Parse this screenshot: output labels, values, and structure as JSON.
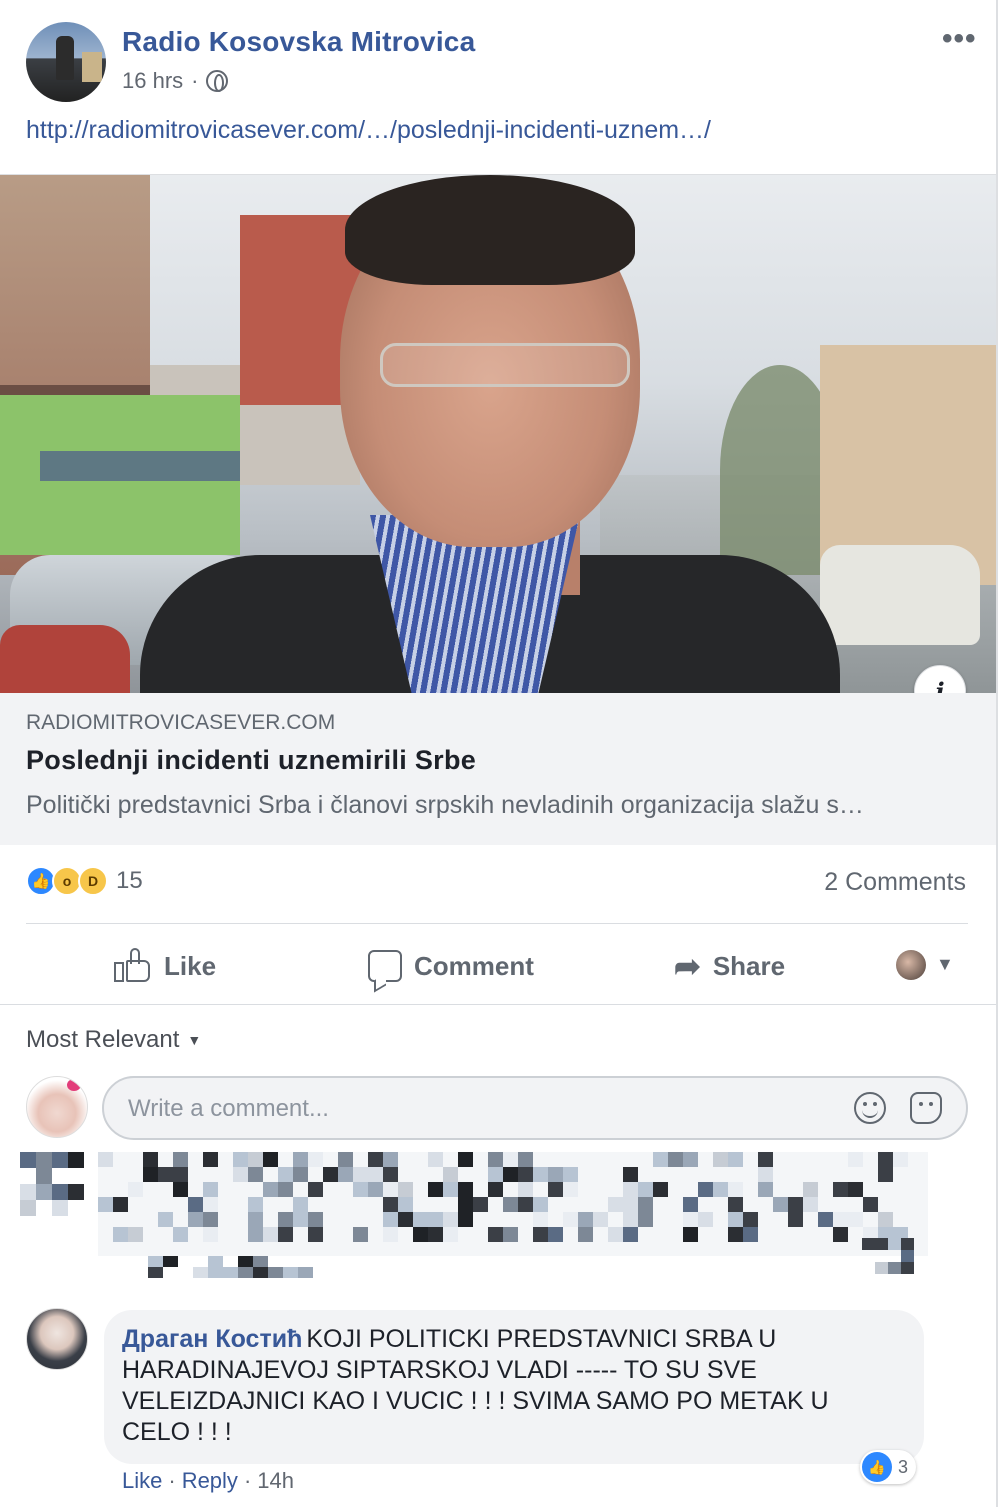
{
  "post": {
    "page_name": "Radio Kosovska Mitrovica",
    "time": "16 hrs",
    "separator": "·",
    "audience_icon": "globe-icon",
    "more_icon": "ellipsis-icon",
    "link_text": "http://radiomitrovicasever.com/…/poslednji-incidenti-uznem…/"
  },
  "preview": {
    "domain": "RADIOMITROVICASEVER.COM",
    "title": "Poslednji incidenti uznemirili Srbe",
    "description": "Politički predstavnici Srba i članovi srpskih nevladinih organizacija slažu s…",
    "info_label": "i"
  },
  "reactions": {
    "icons": [
      "like-reaction-icon",
      "wow-reaction-icon",
      "haha-reaction-icon"
    ],
    "count": "15",
    "comments_count": "2 Comments"
  },
  "actions": {
    "like": "Like",
    "comment": "Comment",
    "share": "Share"
  },
  "comments_section": {
    "sort_label": "Most Relevant",
    "composer_placeholder": "Write a comment..."
  },
  "comments": [
    {
      "author": "Драган Костић",
      "text": "KOJI POLITICKI PREDSTAVNICI SRBA U HARADINAJEVOJ SIPTARSKOJ VLADI ----- TO SU SVE VELEIZDAJNICI KAO I VUCIC ! ! ! SVIMA SAMO PO METAK U CELO ! ! !",
      "like_label": "Like",
      "reply_label": "Reply",
      "time": "14h",
      "reaction_count": "3"
    }
  ],
  "colors": {
    "link_blue": "#385898",
    "meta_gray": "#606770",
    "bubble_bg": "#f2f3f5",
    "like_blue": "#2d88ff"
  }
}
